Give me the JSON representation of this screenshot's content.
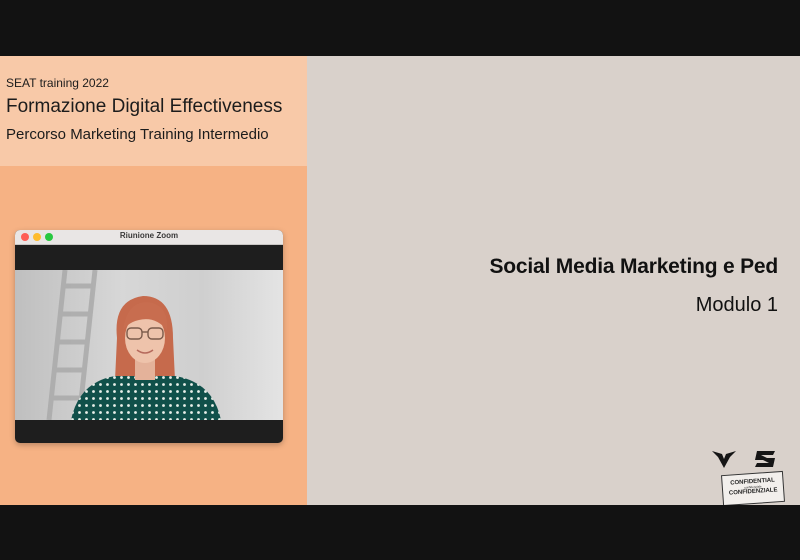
{
  "header": {
    "program": "SEAT training 2022",
    "course_title": "Formazione Digital Effectiveness",
    "course_path": "Percorso Marketing Training Intermedio"
  },
  "zoom": {
    "window_title": "Riunione Zoom"
  },
  "slide": {
    "title": "Social Media Marketing e Ped",
    "module": "Modulo 1"
  },
  "badge": {
    "line1": "CONFIDENTIAL",
    "line2": "confidenziale",
    "line3": "CONFIDENZIALE"
  },
  "icons": {
    "cupra": "cupra-logo-icon",
    "seat": "seat-logo-icon"
  },
  "colors": {
    "left_panel": "#f6b284",
    "header_band": "#f8c9a8",
    "slide_bg": "#d9d1cb",
    "letterbox": "#121212"
  }
}
